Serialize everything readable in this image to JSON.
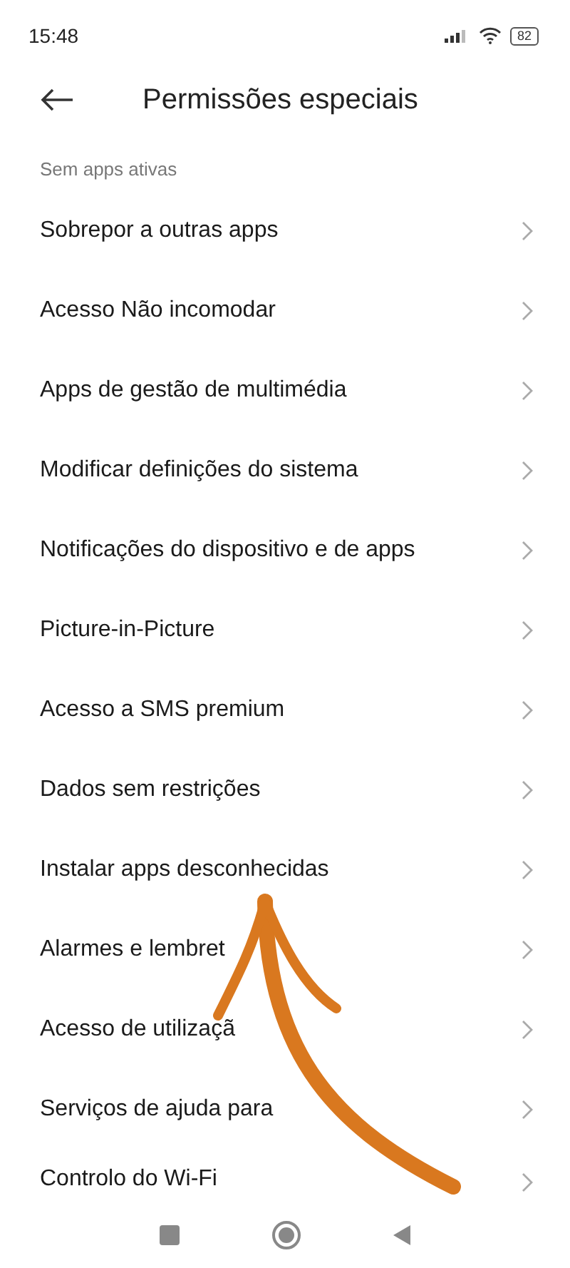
{
  "status_bar": {
    "time": "15:48",
    "battery": "82"
  },
  "header": {
    "title": "Permissões especiais"
  },
  "partial_item": {
    "subtitle": "Sem apps ativas"
  },
  "items": [
    {
      "label": "Sobrepor a outras apps"
    },
    {
      "label": "Acesso Não incomodar"
    },
    {
      "label": "Apps de gestão de multimédia"
    },
    {
      "label": "Modificar definições do sistema"
    },
    {
      "label": "Notificações do dispositivo e de apps"
    },
    {
      "label": "Picture-in-Picture"
    },
    {
      "label": "Acesso a SMS premium"
    },
    {
      "label": "Dados sem restrições"
    },
    {
      "label": "Instalar apps desconhecidas"
    },
    {
      "label": "Alarmes e lembret"
    },
    {
      "label": "Acesso de utilizaçã"
    },
    {
      "label": "Serviços de ajuda para"
    },
    {
      "label": "Controlo do Wi-Fi"
    }
  ]
}
